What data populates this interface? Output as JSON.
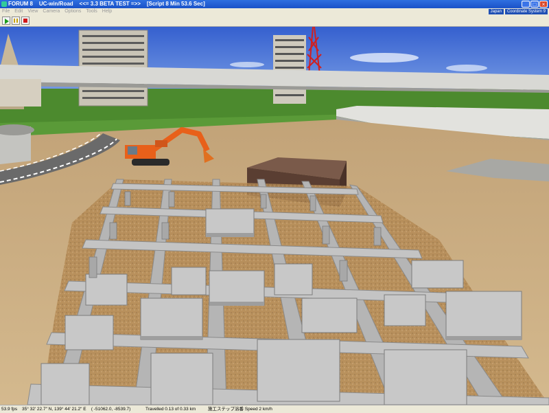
{
  "window": {
    "title": "FORUM 8    UC-win/Road    <<= 3.3 BETA TEST =>>    [Script 8 Min 53.6 Sec]",
    "minimize": "_",
    "maximize": "□",
    "close": "×"
  },
  "menu": {
    "items": [
      "File",
      "Edit",
      "View",
      "Camera",
      "Options",
      "Tools",
      "Help"
    ],
    "language": "Japan",
    "coordinate_system": "Coordinate System 9"
  },
  "toolbar": {
    "play_icon": "play-icon",
    "pause_icon": "pause-icon",
    "stop_icon": "stop-icon"
  },
  "status": {
    "fps": "53.9 fps",
    "coordinates": "35° 32' 22.7\" N, 139° 44' 21.2\" E    ( -51062.0, -8539.7)",
    "travelled": "Travelled 0.13 of 0.33 km",
    "step": "施工ステップ浴番 Speed 2 km/h"
  },
  "colors": {
    "sky": "#3e6bd6",
    "grass": "#4c8a2e",
    "dirt": "#c9ac80",
    "concrete": "#b8b8b8",
    "excavator": "#e8601a"
  }
}
